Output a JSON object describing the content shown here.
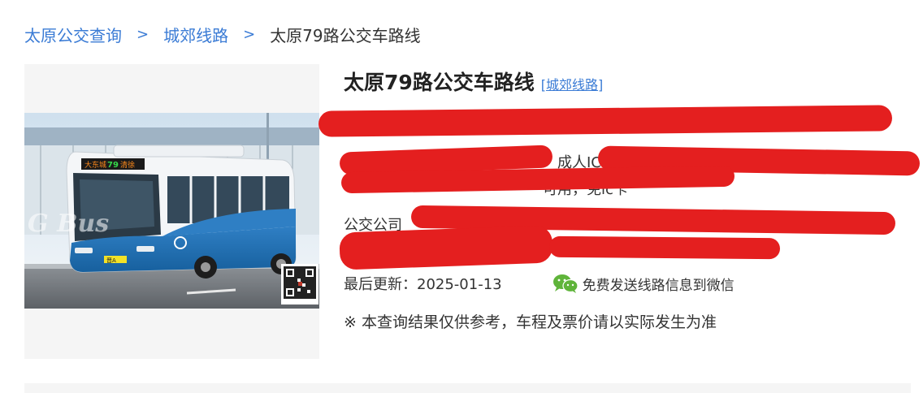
{
  "breadcrumb": {
    "home": "太原公交查询",
    "separator": ">",
    "category": "城郊线路",
    "current": "太原79路公交车路线"
  },
  "route": {
    "title": "太原79路公交车路线",
    "category_tag": "[城郊线路]"
  },
  "fare": {
    "visible_text": "成人IC卡1.25元",
    "hours_fragment": "可用，免ic卡"
  },
  "company": {
    "label": "公交公司"
  },
  "update": {
    "label": "最后更新：2025-01-13"
  },
  "wechat": {
    "icon": "wechat-icon",
    "label": "免费发送线路信息到微信"
  },
  "disclaimer": "※ 本查询结果仅供参考，车程及票价请以实际发生为准",
  "photo": {
    "sign_left": "大东城",
    "sign_number": "79",
    "sign_right": "清徐",
    "plate": "晋A",
    "watermark": "G Bus"
  },
  "colors": {
    "link": "#3a7bd5",
    "redaction": "#e41f1f",
    "panel_bg": "#f5f5f5",
    "wechat_green": "#5fb43a"
  }
}
